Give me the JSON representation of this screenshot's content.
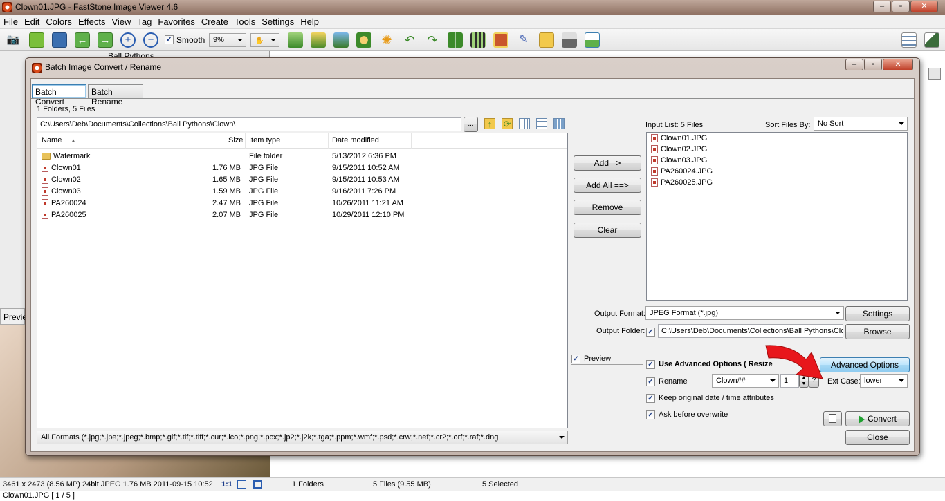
{
  "app": {
    "title": "Clown01.JPG  -  FastStone Image Viewer 4.6",
    "menu": [
      "File",
      "Edit",
      "Colors",
      "Effects",
      "View",
      "Tag",
      "Favorites",
      "Create",
      "Tools",
      "Settings",
      "Help"
    ],
    "toolbar": {
      "smooth_label": "Smooth",
      "smooth_checked": true,
      "zoom_value": "9%"
    },
    "tree_item": "Ball Pythons",
    "preview_tab": "Previe",
    "status": {
      "image_info": "3461 x 2473 (8.56 MP)  24bit  JPEG  1.76 MB  2011-09-15 10:52",
      "ratio": "1:1",
      "folders": "1 Folders",
      "files": "5 Files (9.55 MB)",
      "selected": "5 Selected"
    },
    "bottom_text": "Clown01.JPG [ 1 / 5 ]"
  },
  "dialog": {
    "title": "Batch Image Convert / Rename",
    "tabs": {
      "convert": "Batch Convert",
      "rename": "Batch Rename"
    },
    "summary": "1 Folders, 5 Files",
    "path": "C:\\Users\\Deb\\Documents\\Collections\\Ball Pythons\\Clown\\",
    "browse_dots": "...",
    "columns": {
      "name": "Name",
      "size": "Size",
      "type": "Item type",
      "date": "Date modified"
    },
    "files": [
      {
        "name": "Watermark",
        "size": "",
        "type": "File folder",
        "date": "5/13/2012 6:36 PM",
        "kind": "folder"
      },
      {
        "name": "Clown01",
        "size": "1.76 MB",
        "type": "JPG File",
        "date": "9/15/2011 10:52 AM",
        "kind": "file"
      },
      {
        "name": "Clown02",
        "size": "1.65 MB",
        "type": "JPG File",
        "date": "9/15/2011 10:53 AM",
        "kind": "file"
      },
      {
        "name": "Clown03",
        "size": "1.59 MB",
        "type": "JPG File",
        "date": "9/16/2011 7:26 PM",
        "kind": "file"
      },
      {
        "name": "PA260024",
        "size": "2.47 MB",
        "type": "JPG File",
        "date": "10/26/2011 11:21 AM",
        "kind": "file"
      },
      {
        "name": "PA260025",
        "size": "2.07 MB",
        "type": "JPG File",
        "date": "10/29/2011 12:10 PM",
        "kind": "file"
      }
    ],
    "filter": "All Formats (*.jpg;*.jpe;*.jpeg;*.bmp;*.gif;*.tif;*.tiff;*.cur;*.ico;*.png;*.pcx;*.jp2;*.j2k;*.tga;*.ppm;*.wmf;*.psd;*.crw;*.nef;*.cr2;*.orf;*.raf;*.dng",
    "buttons": {
      "add": "Add =>",
      "add_all": "Add All ==>",
      "remove": "Remove",
      "clear": "Clear",
      "settings": "Settings",
      "browse": "Browse",
      "advanced": "Advanced Options",
      "convert": "Convert",
      "close": "Close",
      "help": "?"
    },
    "input_list_label": "Input List:  5 Files",
    "sort_label": "Sort Files By:",
    "sort_value": "No Sort",
    "input_files": [
      "Clown01.JPG",
      "Clown02.JPG",
      "Clown03.JPG",
      "PA260024.JPG",
      "PA260025.JPG"
    ],
    "output_format_label": "Output Format:",
    "output_format": "JPEG Format (*.jpg)",
    "output_folder_label": "Output Folder:",
    "output_folder": "C:\\Users\\Deb\\Documents\\Collections\\Ball Pythons\\Clov",
    "preview_label": "Preview",
    "use_advanced_label": "Use Advanced Options ( Resize",
    "rename_label": "Rename",
    "rename_pattern": "Clown##",
    "rename_start": "1",
    "ext_case_label": "Ext Case:",
    "ext_case_value": "lower",
    "keep_date_label": "Keep original date / time attributes",
    "ask_overwrite_label": "Ask before overwrite",
    "checks": {
      "output_folder": true,
      "preview": true,
      "use_advanced": true,
      "rename": true,
      "keep_date": true,
      "ask_overwrite": true
    }
  },
  "colors": {
    "accent": "#3c7fb1",
    "arrow": "#e8161b"
  }
}
